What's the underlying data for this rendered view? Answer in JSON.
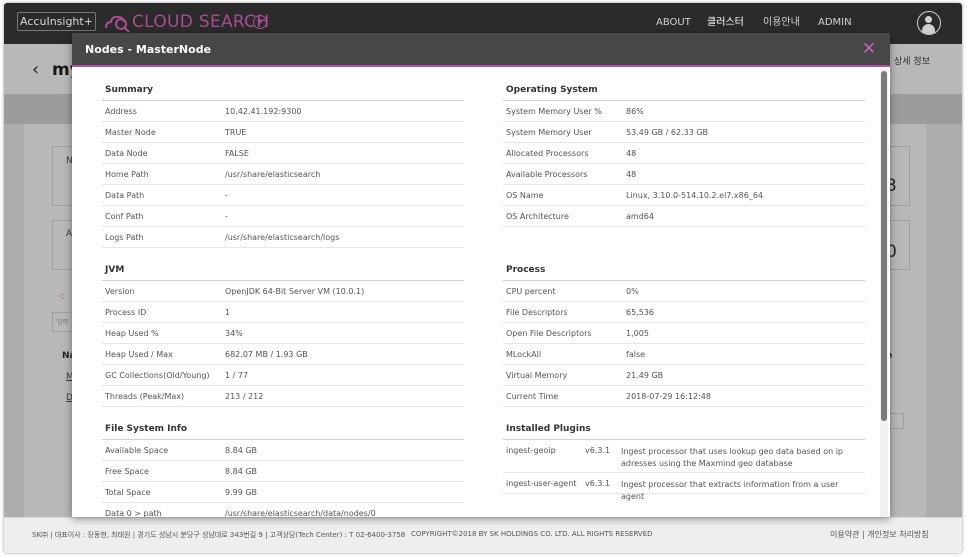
{
  "topnav": {
    "brand": "AccuInsight+",
    "app_title": "CLOUD SEARCH",
    "links": [
      "ABOUT",
      "클러스터",
      "이용안내",
      "ADMIN"
    ],
    "active_link": "클러스터"
  },
  "page": {
    "title_peek": "my",
    "detail_link": "상세 정보",
    "peek_left": [
      "No",
      "Ac",
      "Na",
      "M",
      "D"
    ],
    "peek_right": [
      "3",
      "0",
      "ze"
    ],
    "search_placeholder_peek": "입력"
  },
  "modal": {
    "title": "Nodes - MasterNode",
    "summary": {
      "title": "Summary",
      "rows": [
        {
          "k": "Address",
          "v": "10.42.41.192:9300"
        },
        {
          "k": "Master Node",
          "v": "TRUE"
        },
        {
          "k": "Data Node",
          "v": "FALSE"
        },
        {
          "k": "Home Path",
          "v": "/usr/share/elasticsearch"
        },
        {
          "k": "Data Path",
          "v": "-"
        },
        {
          "k": "Conf Path",
          "v": "-"
        },
        {
          "k": "Logs Path",
          "v": "/usr/share/elasticsearch/logs"
        }
      ]
    },
    "os": {
      "title": "Operating System",
      "rows": [
        {
          "k": "System Memory User %",
          "v": "86%"
        },
        {
          "k": "System Memory User",
          "v": "53.49 GB / 62.33 GB"
        },
        {
          "k": "Allocated Processors",
          "v": "48"
        },
        {
          "k": "Available Processors",
          "v": "48"
        },
        {
          "k": "OS Name",
          "v": "Linux, 3.10.0-514.10.2.el7.x86_64"
        },
        {
          "k": "OS Architecture",
          "v": "amd64"
        }
      ]
    },
    "jvm": {
      "title": "JVM",
      "rows": [
        {
          "k": "Version",
          "v": "OpenJDK 64-Bit Server VM (10.0.1)"
        },
        {
          "k": "Process ID",
          "v": "1"
        },
        {
          "k": "Heap Used %",
          "v": "34%"
        },
        {
          "k": "Heap Used / Max",
          "v": "682.07 MB / 1.93 GB"
        },
        {
          "k": "GC Collections(Old/Young)",
          "v": "1 / 77"
        },
        {
          "k": "Threads (Peak/Max)",
          "v": "213 / 212"
        }
      ]
    },
    "process": {
      "title": "Process",
      "rows": [
        {
          "k": "CPU percent",
          "v": "0%"
        },
        {
          "k": "File Descriptors",
          "v": "65,536"
        },
        {
          "k": "Open File Descriptors",
          "v": "1,005"
        },
        {
          "k": "MLockAll",
          "v": "false"
        },
        {
          "k": "Virtual Memory",
          "v": "21.49 GB"
        },
        {
          "k": "Current Time",
          "v": "2018-07-29 16:12:48"
        }
      ]
    },
    "fs": {
      "title": "File System Info",
      "rows": [
        {
          "k": "Available Space",
          "v": "8.84 GB"
        },
        {
          "k": "Free Space",
          "v": "8.84 GB"
        },
        {
          "k": "Total Space",
          "v": "9.99 GB"
        },
        {
          "k": "Data 0 > path",
          "v": "/usr/share/elasticsearch/data/nodes/0"
        }
      ]
    },
    "plugins": {
      "title": "Installed Plugins",
      "rows": [
        {
          "name": "ingest-geoip",
          "version": "v6.3.1",
          "desc": "Ingest processor that uses lookup geo data based on ip adresses using the Maxmind geo database"
        },
        {
          "name": "ingest-user-agent",
          "version": "v6.3.1",
          "desc": "Ingest processor that extracts information from a user agent"
        }
      ]
    }
  },
  "footer": {
    "left": "SK㈜ | 대표이사 : 장동현, 최태원 | 경기도 성남시 분당구 성남대로 343번길 9 | 고객상담(Tech Center) : T 02-6400-3758",
    "copyright": "COPYRIGHT©2018 BY SK HOLDINGS CO. LTD. ALL RIGHTS RESERVED",
    "right": "이용약관 | 개인정보 처리방침"
  },
  "colors": {
    "brand": "#a84d92",
    "modal_header": "#474747",
    "nav_bg": "#2b2b2b",
    "accent_line": "#b64fa0"
  }
}
